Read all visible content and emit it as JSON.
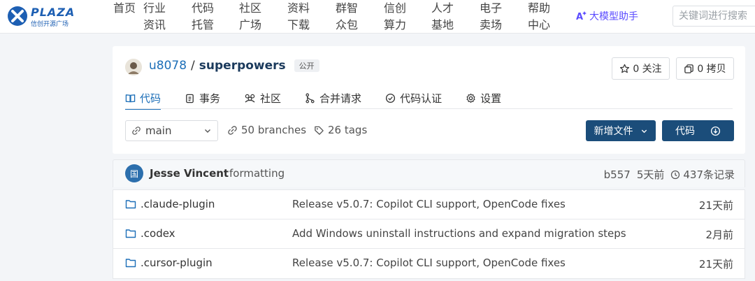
{
  "brand": {
    "logo_text": "PLAZA",
    "logo_sub": "信创开源广场",
    "accent": "#1d6fb8",
    "primary_button": "#1b4d7a"
  },
  "nav": {
    "items": [
      {
        "label": "首页"
      },
      {
        "label": "行业资讯"
      },
      {
        "label": "代码托管"
      },
      {
        "label": "社区广场"
      },
      {
        "label": "资料下载"
      },
      {
        "label": "群智众包"
      },
      {
        "label": "信创算力"
      },
      {
        "label": "人才基地"
      },
      {
        "label": "电子卖场"
      },
      {
        "label": "帮助中心"
      }
    ],
    "ai_label": "大模型助手",
    "search_placeholder": "关键词进行搜索"
  },
  "repo": {
    "owner": "u8078",
    "separator": "/",
    "name": "superpowers",
    "visibility": "公开",
    "star_label": "0 关注",
    "fork_label": "0 拷贝",
    "tabs": [
      {
        "label": "代码",
        "icon": "book-icon"
      },
      {
        "label": "事务",
        "icon": "clipboard-icon"
      },
      {
        "label": "社区",
        "icon": "community-icon"
      },
      {
        "label": "合并请求",
        "icon": "merge-icon"
      },
      {
        "label": "代码认证",
        "icon": "check-circle-icon"
      },
      {
        "label": "设置",
        "icon": "gear-icon"
      }
    ],
    "branch": "main",
    "branches_label": "50 branches",
    "tags_label": "26 tags",
    "new_file_label": "新增文件",
    "code_label": "代码"
  },
  "commit": {
    "avatar_text": "国",
    "author": "Jesse Vincent",
    "message": "formatting",
    "sha": "b557",
    "time": "5天前",
    "count_label": "437条记录"
  },
  "files": [
    {
      "name": ".claude-plugin",
      "message": "Release v5.0.7: Copilot CLI support, OpenCode fixes",
      "time": "21天前"
    },
    {
      "name": ".codex",
      "message": "Add Windows uninstall instructions and expand migration steps",
      "time": "2月前"
    },
    {
      "name": ".cursor-plugin",
      "message": "Release v5.0.7: Copilot CLI support, OpenCode fixes",
      "time": "21天前"
    }
  ]
}
